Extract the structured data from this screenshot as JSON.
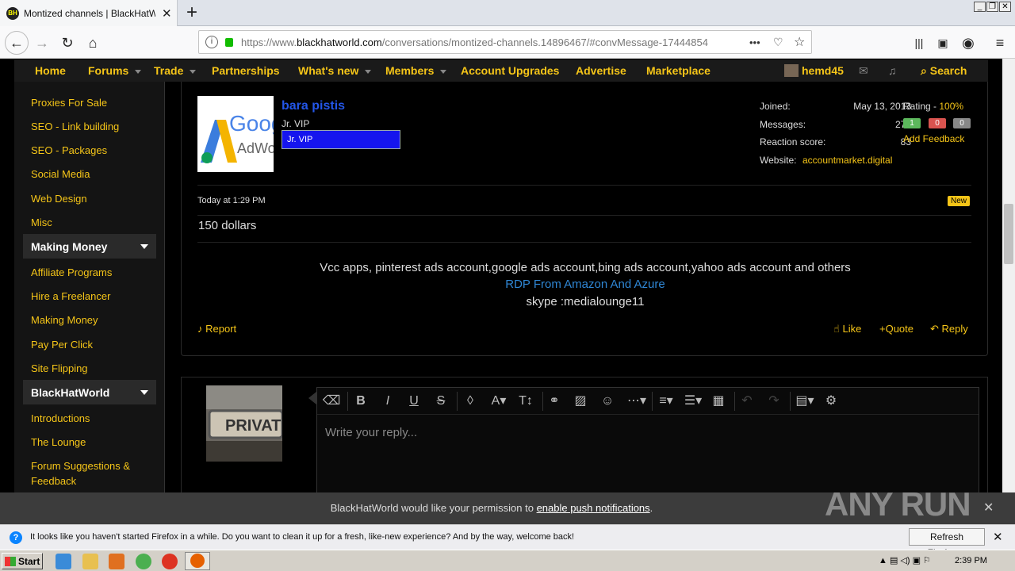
{
  "browser": {
    "tab_title": "Montized channels | BlackHatWorld",
    "tab_close": "✕",
    "new_tab": "+",
    "url_prefix": "https://www.",
    "url_host": "blackhatworld.com",
    "url_path": "/conversations/montized-channels.14896467/#convMessage-17444854",
    "url_more": "•••",
    "window_buttons": [
      "_",
      "❐",
      "✕"
    ]
  },
  "site_nav": {
    "items": [
      "Home",
      "Forums",
      "Trade",
      "Partnerships",
      "What's new",
      "Members",
      "Account Upgrades",
      "Advertise",
      "Marketplace"
    ],
    "user": "hemd45",
    "search": "Search"
  },
  "sidebar": {
    "links_top": [
      "Proxies For Sale",
      "SEO - Link building",
      "SEO - Packages",
      "Social Media",
      "Web Design",
      "Misc"
    ],
    "section1": "Making Money",
    "links_mid": [
      "Affiliate Programs",
      "Hire a Freelancer",
      "Making Money",
      "Pay Per Click",
      "Site Flipping"
    ],
    "section2": "BlackHatWorld",
    "links_bottom": [
      "Introductions",
      "The Lounge",
      "Forum Suggestions &",
      "Feedback"
    ]
  },
  "post": {
    "username": "bara pistis",
    "user_title": "Jr. VIP",
    "user_banner": "Jr. VIP",
    "avatar_text": "Goog",
    "avatar_text2": "AdWo",
    "joined_label": "Joined:",
    "joined_value": "May 13, 2013",
    "messages_label": "Messages:",
    "messages_value": "276",
    "reaction_label": "Reaction score:",
    "reaction_value": "83",
    "website_label": "Website:",
    "website_value": "accountmarket.digital",
    "rating_label": "Rating - ",
    "rating_value": "100%",
    "feedback_pos": "1",
    "feedback_neg": "0",
    "feedback_neu": "0",
    "add_feedback": "Add Feedback",
    "timestamp": "Today at 1:29 PM",
    "new_badge": "New",
    "body": "150 dollars",
    "sig_line1": "Vcc apps, pinterest ads account,google ads account,bing ads account,yahoo ads account and others",
    "sig_line2": "RDP From Amazon And Azure",
    "sig_line3": "skype :medialounge11",
    "report": "Report",
    "like": "Like",
    "quote": "Quote",
    "reply": "Reply",
    "colors": {
      "positive": "#5cb85c",
      "negative": "#d9534f",
      "neutral": "#888888",
      "link": "#2f86d4"
    }
  },
  "reply_box": {
    "avatar_text": "PRIVAT",
    "placeholder": "Write your reply..."
  },
  "push_bar": {
    "text_before": "BlackHatWorld would like your permission to ",
    "link": "enable push notifications",
    "text_after": "."
  },
  "firefox_bar": {
    "message": "It looks like you haven't started Firefox in a while. Do you want to clean it up for a fresh, like-new experience? And by the way, welcome back!",
    "button": "Refresh Firefox…"
  },
  "taskbar": {
    "start": "Start",
    "clock": "2:39 PM"
  },
  "watermark": "ANY RUN"
}
